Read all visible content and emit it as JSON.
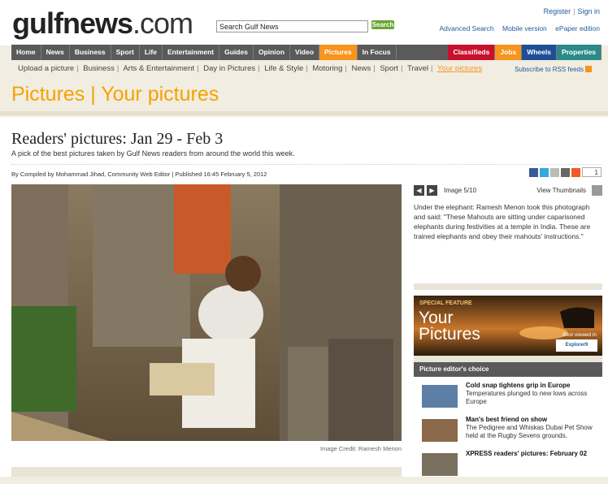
{
  "header": {
    "logo_main": "gulfnews",
    "logo_suffix": ".com",
    "search_placeholder": "Search Gulf News",
    "search_button": "Search",
    "register": "Register",
    "signin": "Sign in",
    "sep": "|",
    "advanced_search": "Advanced Search",
    "mobile_version": "Mobile version",
    "epaper": "ePaper edition"
  },
  "mainnav": {
    "items": [
      "Home",
      "News",
      "Business",
      "Sport",
      "Life",
      "Entertainment",
      "Guides",
      "Opinion",
      "Video",
      "Pictures",
      "In Focus"
    ],
    "active_index": 9,
    "right_items": [
      "Classifieds",
      "Jobs",
      "Wheels",
      "Properties"
    ]
  },
  "subnav": {
    "items": [
      "Upload a picture",
      "Business",
      "Arts & Entertainment",
      "Day in Pictures",
      "Life & Style",
      "Motoring",
      "News",
      "Sport",
      "Travel",
      "Your pictures"
    ],
    "active_index": 9,
    "rss": "Subscribe to RSS feeds"
  },
  "section_title": "Pictures | Your pictures",
  "article": {
    "title": "Readers' pictures: Jan 29 - Feb 3",
    "subtitle": "A pick of the best pictures taken by Gulf News readers from around the world this week.",
    "byline": "By Compiled by Mohammad Jihad, Community Web Editor | Published 16:45 February 5, 2012",
    "share_count": "1",
    "image_credit": "Image Credit: Ramesh Menon"
  },
  "gallery": {
    "prev": "◀",
    "next": "▶",
    "image_counter": "Image 5/10",
    "view_thumbnails": "View Thumbnails",
    "caption": "Under the elephant: Ramesh Menon took this photograph and said: \"These Mahouts are sitting under caparisoned elephants during festivities at a temple in India. These are trained elephants and obey their mahouts' instructions.\""
  },
  "promo": {
    "special": "SPECIAL FEATURE",
    "title_line1": "Your",
    "title_line2": "Pictures",
    "best_viewed": "Best viewed in",
    "browser": "Explorer9"
  },
  "picture_editors_choice": {
    "heading": "Picture editor's choice",
    "items": [
      {
        "title": "Cold snap tightens grip in Europe",
        "desc": "Temperatures plunged to new lows across Europe"
      },
      {
        "title": "Man's best friend on show",
        "desc": "The Pedigree and Whiskas Dubai Pet Show held at the Rugby Sevens grounds."
      },
      {
        "title": "XPRESS readers' pictures: February 02",
        "desc": ""
      }
    ]
  },
  "colors": {
    "accent_orange": "#f7941d",
    "nav_gray": "#5a5a5a",
    "link_blue": "#1f5a9c",
    "search_green": "#69a630"
  }
}
